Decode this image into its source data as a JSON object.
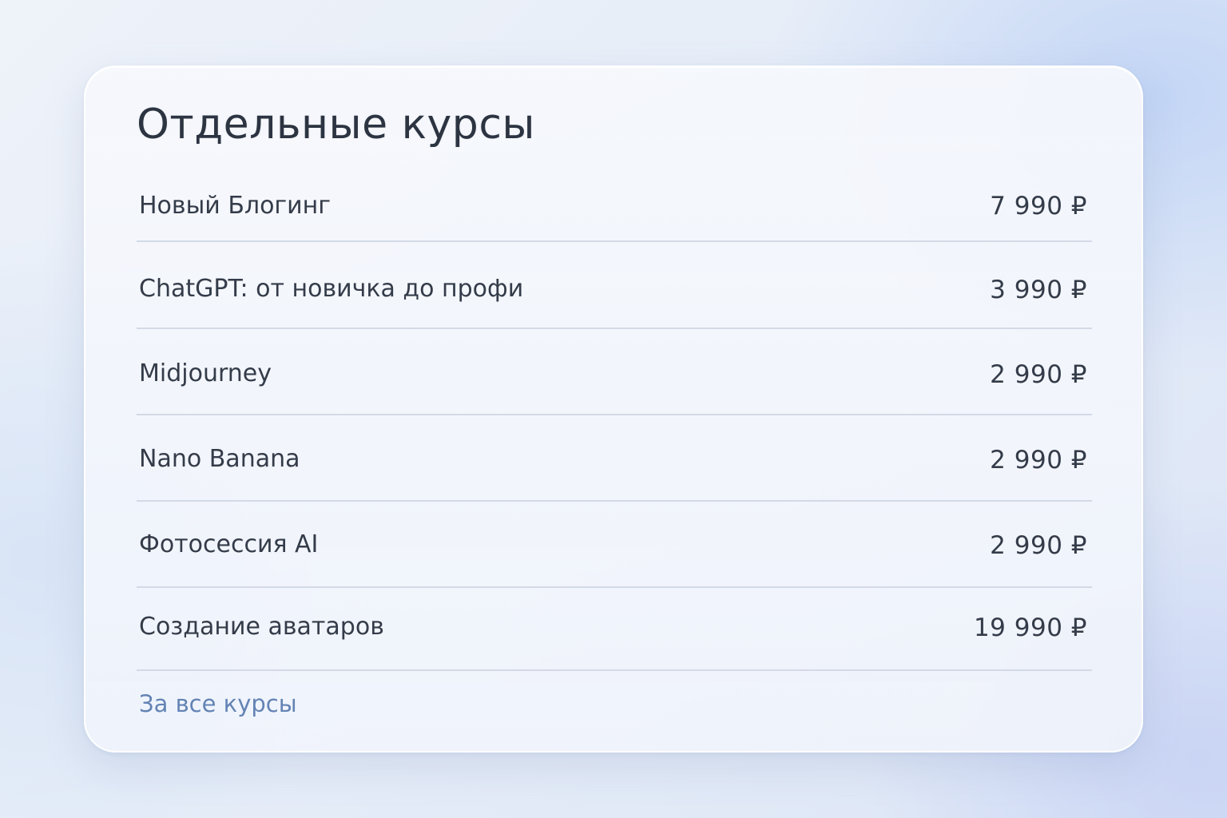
{
  "card": {
    "title": "Отдельные курсы",
    "courses": [
      {
        "name": "Новый Блогинг",
        "price": "7 990 ₽"
      },
      {
        "name": "ChatGPT: от новичка до профи",
        "price": "3 990 ₽"
      },
      {
        "name": "Midjourney",
        "price": "2 990 ₽"
      },
      {
        "name": "Nano Banana",
        "price": "2 990 ₽"
      },
      {
        "name": "Фотосессия AI",
        "price": "2 990 ₽"
      },
      {
        "name": "Создание аватаров",
        "price": "19 990 ₽"
      }
    ],
    "footer_link": "За все курсы"
  }
}
